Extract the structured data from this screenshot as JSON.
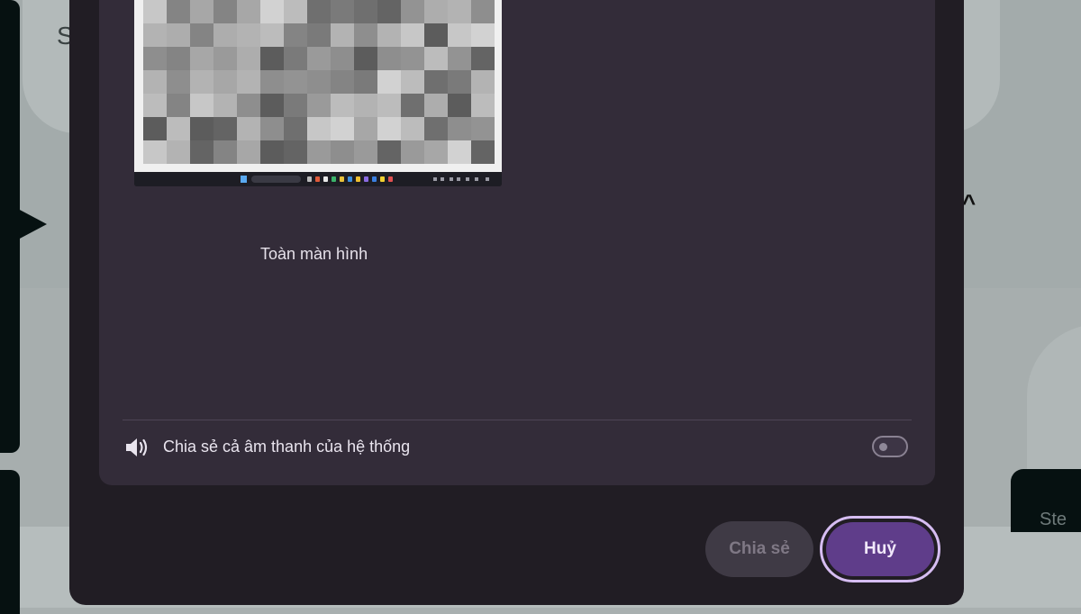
{
  "background": {
    "partial_heading": "S",
    "partial_card_text": "Ste"
  },
  "dialog": {
    "source": {
      "label": "Toàn màn hình",
      "thumbnail": "blurred-screen-preview"
    },
    "audio": {
      "label": "Chia sẻ cả âm thanh của hệ thống",
      "icon": "speaker-icon",
      "enabled": false
    },
    "buttons": {
      "share": "Chia sẻ",
      "cancel": "Huỷ"
    }
  },
  "colors": {
    "dialog_bg": "#211d24",
    "panel_bg": "#332c39",
    "accent": "#5f3d8a",
    "accent_outline": "#d6bdf2",
    "disabled_button": "#3f3a45"
  }
}
